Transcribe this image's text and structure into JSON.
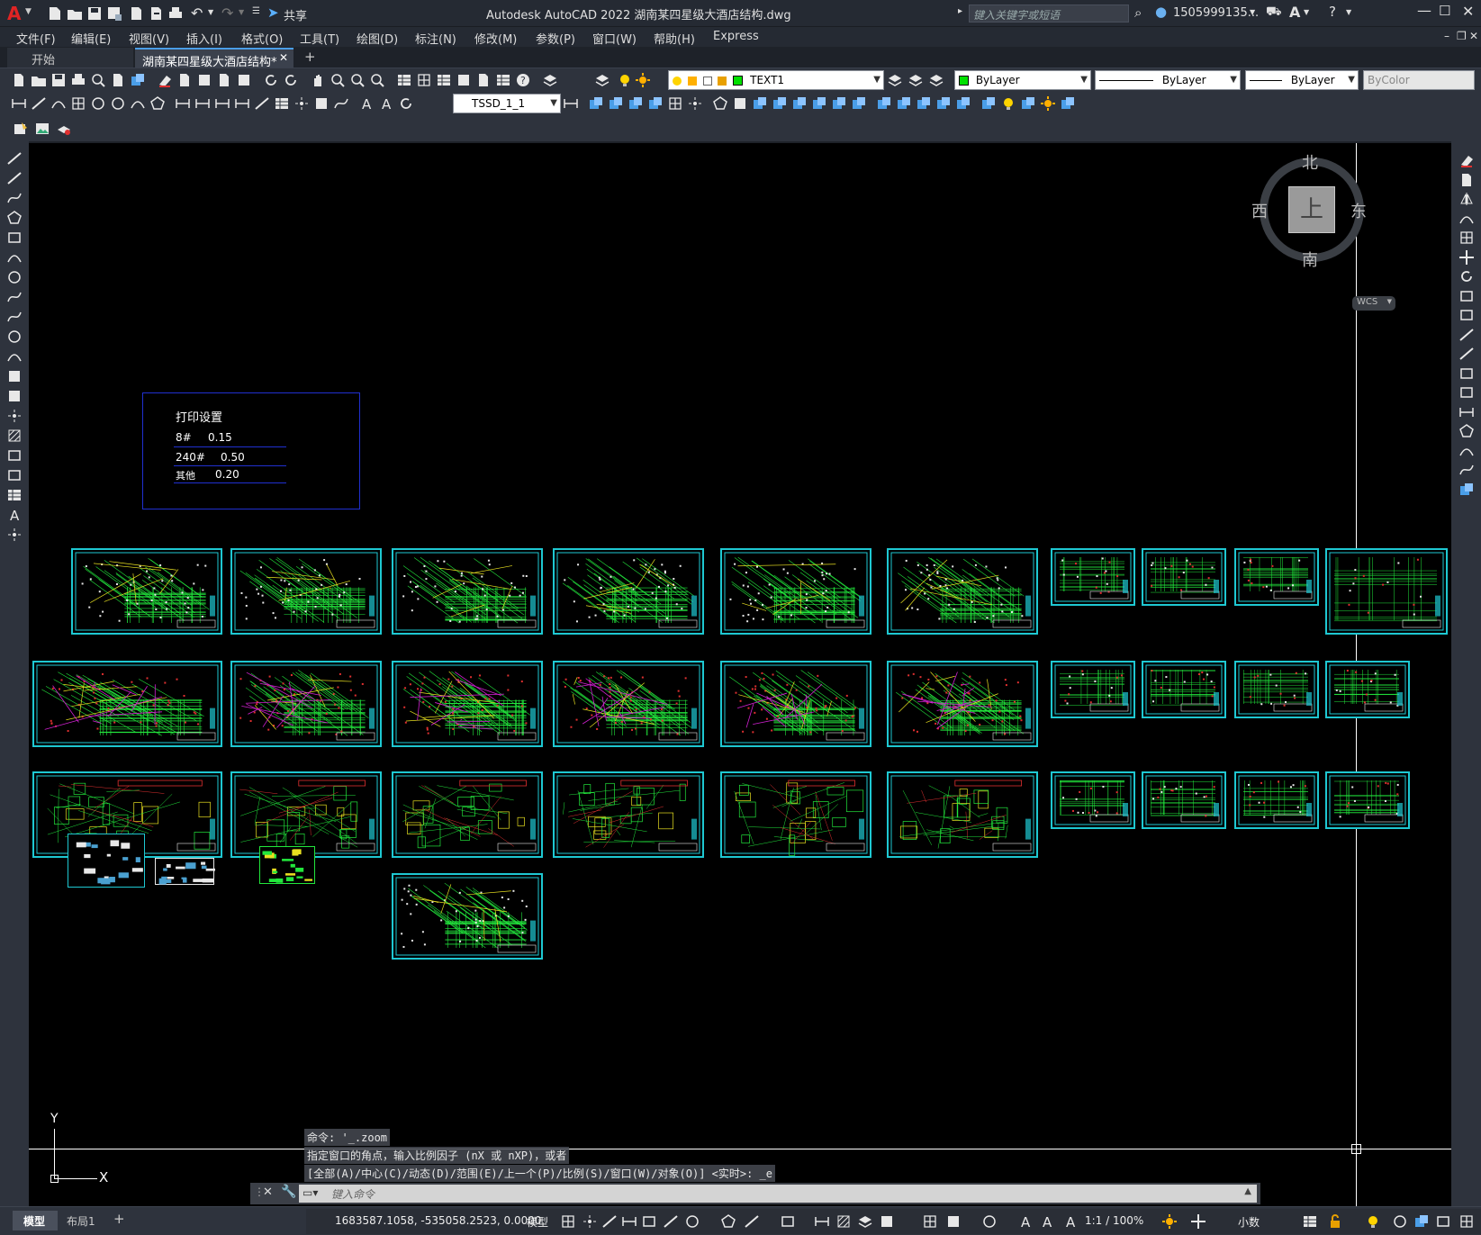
{
  "titlebar": {
    "app_icon": "A",
    "title": "Autodesk AutoCAD 2022    湖南某四星级大酒店结构.dwg",
    "share": "共享",
    "search_placeholder": "键入关键字或短语",
    "user": "1505999135...",
    "icons": [
      "new-icon",
      "open-icon",
      "save-icon",
      "saveas-icon",
      "plot-icon",
      "undo-icon",
      "redo-icon",
      "share-icon",
      "search-icon",
      "user-icon",
      "cart-icon",
      "autodesk-icon",
      "help-icon",
      "minimize-icon",
      "maximize-icon",
      "close-icon"
    ]
  },
  "menubar": {
    "items": [
      "文件(F)",
      "编辑(E)",
      "视图(V)",
      "插入(I)",
      "格式(O)",
      "工具(T)",
      "绘图(D)",
      "标注(N)",
      "修改(M)",
      "参数(P)",
      "窗口(W)",
      "帮助(H)",
      "Express"
    ]
  },
  "tabs": {
    "start": "开始",
    "active": "湖南某四星级大酒店结构*",
    "add": "+"
  },
  "toolbar": {
    "layer_value": "TEXT1",
    "color_value": "ByLayer",
    "linetype_value": "ByLayer",
    "lineweight_value": "ByLayer",
    "plotstyle_value": "ByColor",
    "dimstyle_value": "TSSD_1_1"
  },
  "viewcube": {
    "north": "北",
    "south": "南",
    "east": "东",
    "west": "西",
    "top": "上",
    "wcs": "WCS"
  },
  "print_settings": {
    "title": "打印设置",
    "rows": [
      {
        "label": "8#",
        "value": "0.15"
      },
      {
        "label": "240#",
        "value": "0.50"
      },
      {
        "label": "其他",
        "value": "0.20"
      }
    ]
  },
  "command": {
    "line1": "命令: '_.zoom",
    "line2": "指定窗口的角点，输入比例因子 (nX 或 nXP)，或者",
    "line3": "[全部(A)/中心(C)/动态(D)/范围(E)/上一个(P)/比例(S)/窗口(W)/对象(O)] <实时>: _e",
    "placeholder": "键入命令"
  },
  "ucs": {
    "x": "X",
    "y": "Y"
  },
  "status": {
    "model_tab": "模型",
    "layout_tab": "布局1",
    "add": "+",
    "coords": "1683587.1058, -535058.2523, 0.0000",
    "model": "模型",
    "scale": "1:1 / 100%",
    "units": "小数"
  },
  "colors": {
    "sheet_border": "#1ec8d2",
    "plan_green": "#22e63c",
    "accent_red": "#e03030",
    "bg": "#000000",
    "ui": "#2e333d"
  }
}
